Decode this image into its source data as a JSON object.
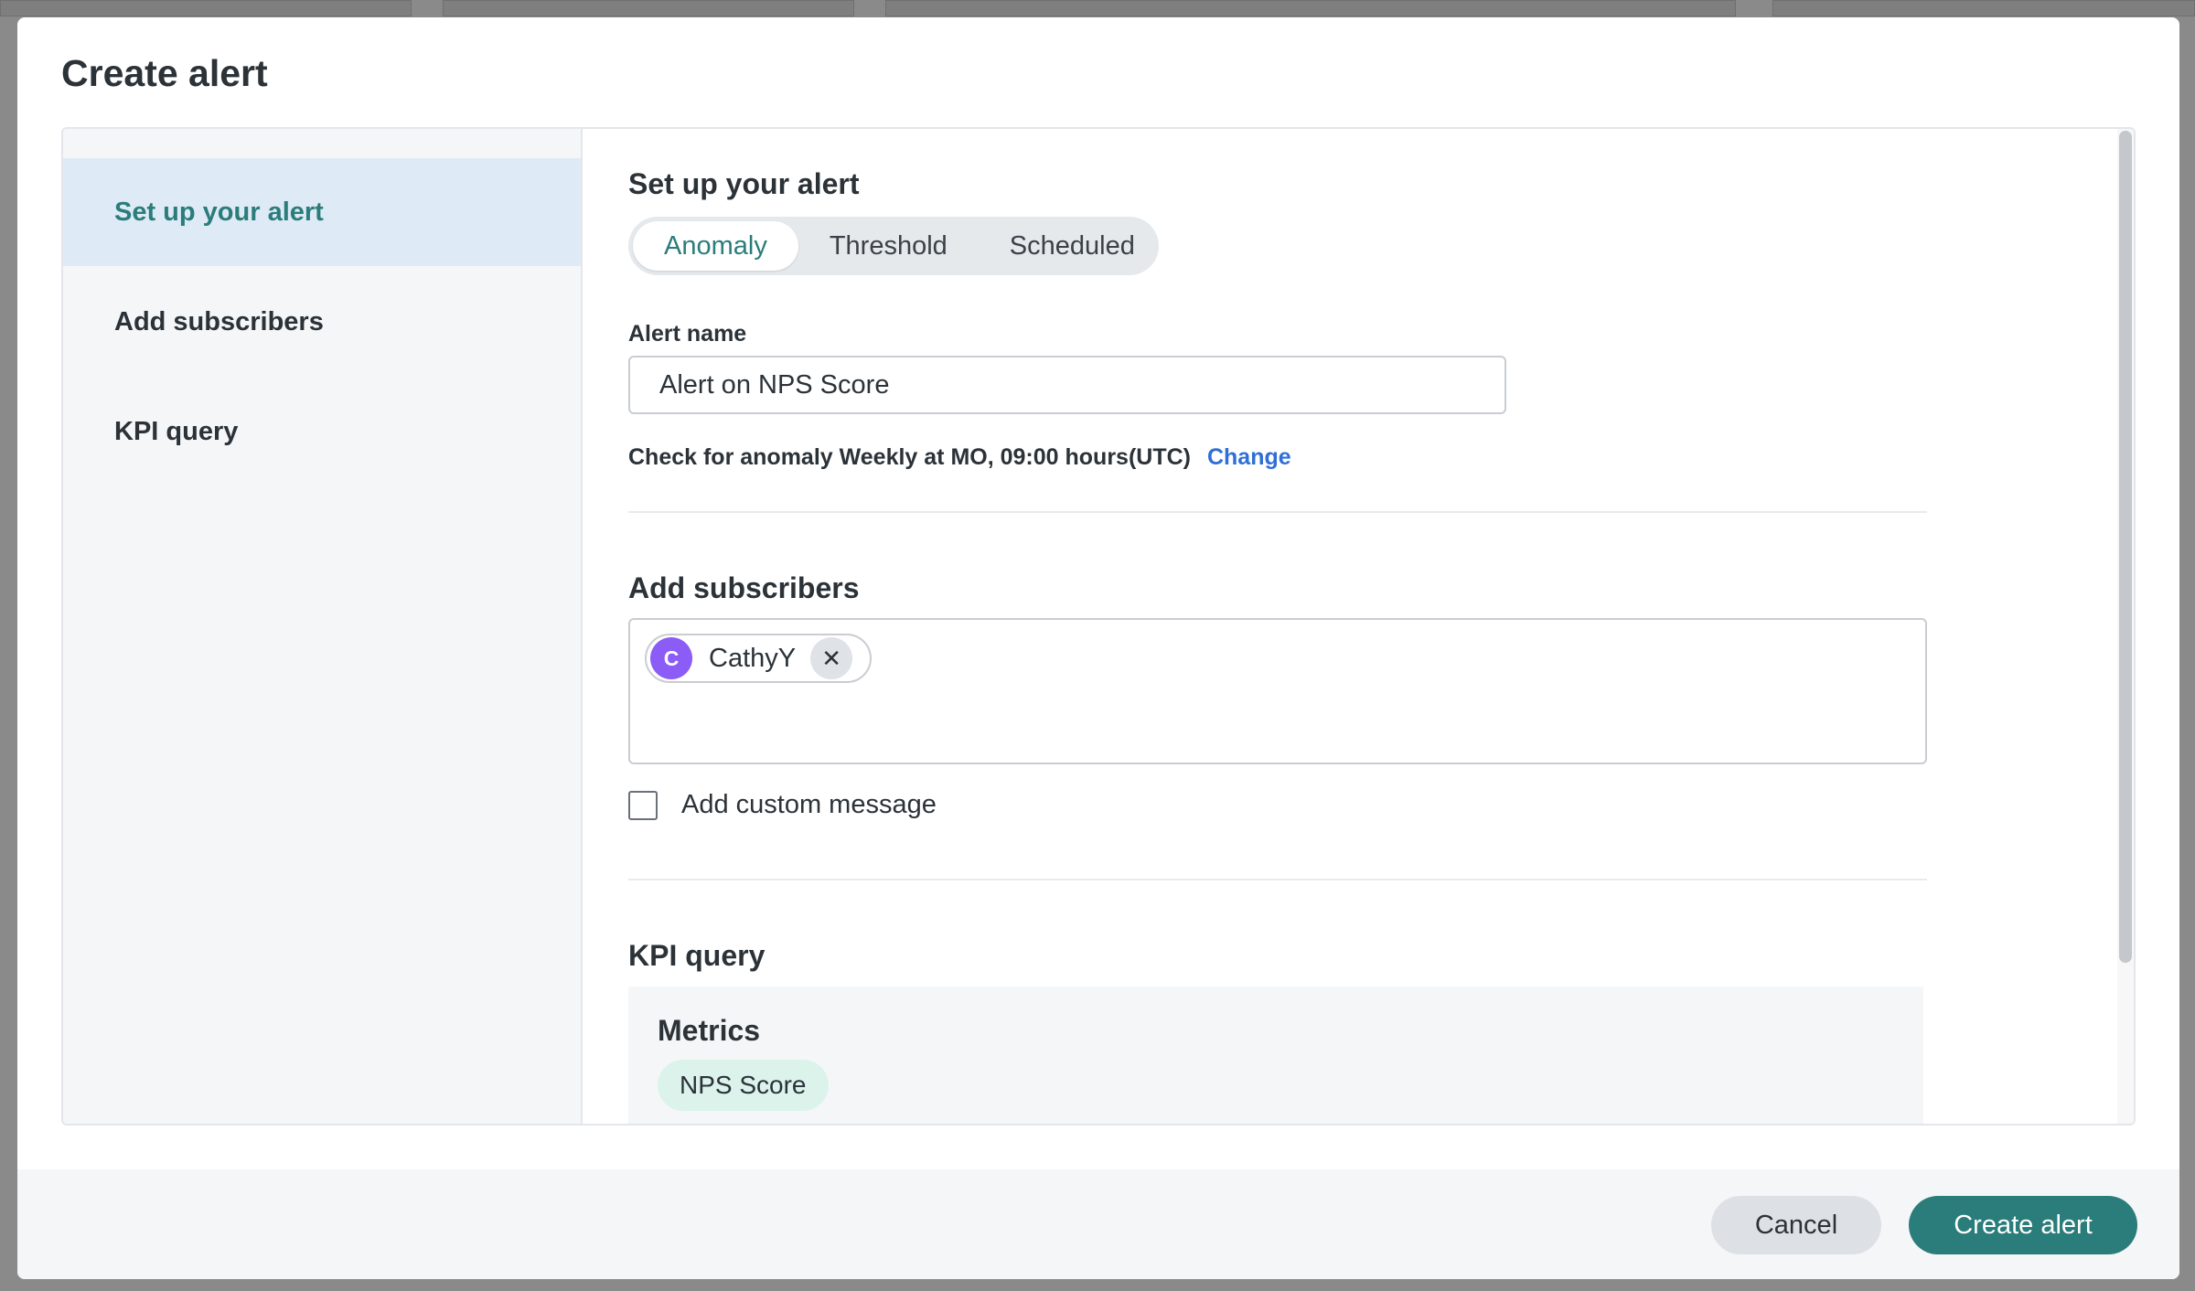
{
  "modal": {
    "title": "Create alert"
  },
  "nav": {
    "items": [
      {
        "label": "Set up your alert",
        "active": true
      },
      {
        "label": "Add subscribers",
        "active": false
      },
      {
        "label": "KPI query",
        "active": false
      }
    ]
  },
  "setup": {
    "section_title": "Set up your alert",
    "alert_types": [
      "Anomaly",
      "Threshold",
      "Scheduled"
    ],
    "selected_type": "Anomaly",
    "alert_name_label": "Alert name",
    "alert_name_value": "Alert on NPS Score",
    "schedule_text": "Check for anomaly Weekly at MO, 09:00 hours(UTC)",
    "change_link": "Change"
  },
  "subscribers": {
    "section_title": "Add subscribers",
    "chips": [
      {
        "initial": "C",
        "name": "CathyY",
        "avatar_color": "#8b5cf6"
      }
    ],
    "custom_message_label": "Add custom message",
    "custom_message_checked": false
  },
  "kpi": {
    "section_title": "KPI query",
    "metrics_title": "Metrics",
    "metrics": [
      "NPS Score"
    ]
  },
  "footer": {
    "cancel_label": "Cancel",
    "create_label": "Create alert"
  },
  "colors": {
    "accent": "#2a7d7a",
    "link": "#2f6fd6",
    "active_nav_bg": "#dfeaf7"
  }
}
